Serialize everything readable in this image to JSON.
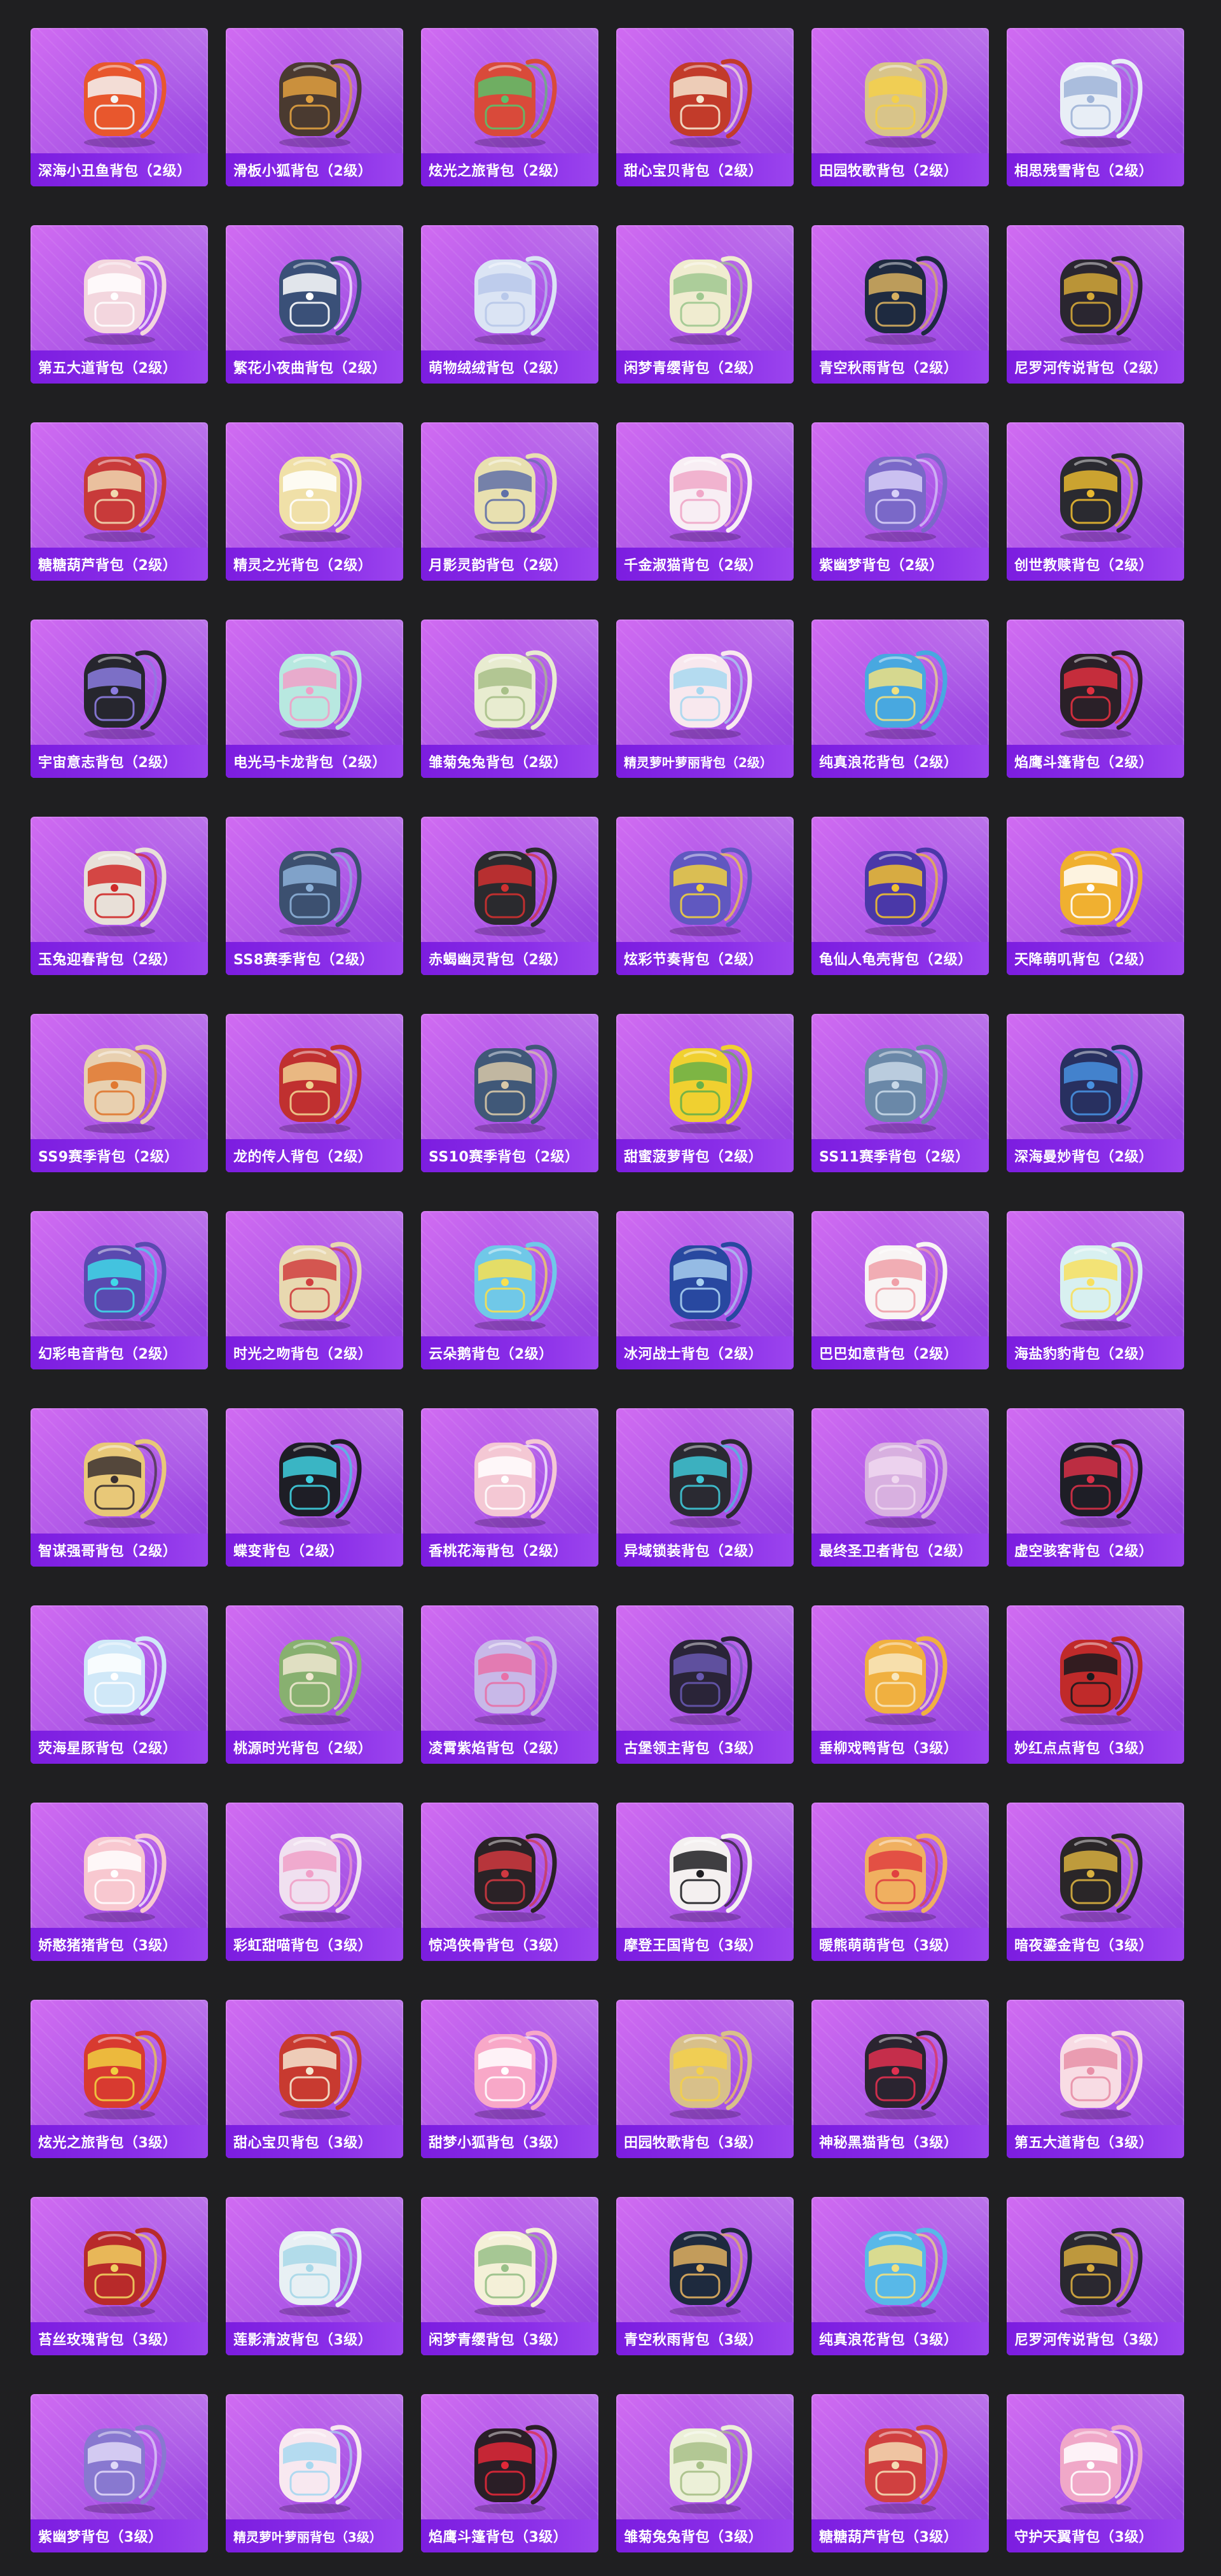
{
  "items": [
    {
      "label": "深海小丑鱼背包（2级）",
      "icon": "clownfish-backpack-icon",
      "color": "#e8572d",
      "accent": "#f4f4f4"
    },
    {
      "label": "滑板小狐背包（2级）",
      "icon": "skate-fox-backpack-icon",
      "color": "#4a3a30",
      "accent": "#e0a040"
    },
    {
      "label": "炫光之旅背包（2级）",
      "icon": "dazzling-trip-backpack-icon",
      "color": "#d94a3a",
      "accent": "#5cc06a"
    },
    {
      "label": "甜心宝贝背包（2级）",
      "icon": "sweetheart-backpack-icon",
      "color": "#c23b2a",
      "accent": "#f5e6d0"
    },
    {
      "label": "田园牧歌背包（2级）",
      "icon": "pastoral-basket-backpack-icon",
      "color": "#d8c48a",
      "accent": "#f4d04a"
    },
    {
      "label": "相思残雪背包（2级）",
      "icon": "snow-lovesick-backpack-icon",
      "color": "#e8eef6",
      "accent": "#9fb4d8"
    },
    {
      "label": "第五大道背包（2级）",
      "icon": "fifth-avenue-backpack-icon",
      "color": "#f3d6de",
      "accent": "#ffffff"
    },
    {
      "label": "繁花小夜曲背包（2级）",
      "icon": "flower-serenade-backpack-icon",
      "color": "#3a5078",
      "accent": "#ffffff"
    },
    {
      "label": "萌物绒绒背包（2级）",
      "icon": "fluffy-plush-backpack-icon",
      "color": "#dbe4f4",
      "accent": "#b8c8ea"
    },
    {
      "label": "闲梦青缨背包（2级）",
      "icon": "dream-tassel-backpack-icon",
      "color": "#f0ecd0",
      "accent": "#a0c890"
    },
    {
      "label": "青空秋雨背包（2级）",
      "icon": "autumn-rain-backpack-icon",
      "color": "#1e2a40",
      "accent": "#d8b060"
    },
    {
      "label": "尼罗河传说背包（2级）",
      "icon": "nile-legend-backpack-icon",
      "color": "#2a2630",
      "accent": "#d4a838"
    },
    {
      "label": "糖糖葫芦背包（2级）",
      "icon": "candied-haw-backpack-icon",
      "color": "#c83a3a",
      "accent": "#f0d8b0"
    },
    {
      "label": "精灵之光背包（2级）",
      "icon": "elf-light-backpack-icon",
      "color": "#f0e0a8",
      "accent": "#ffffff"
    },
    {
      "label": "月影灵韵背包（2级）",
      "icon": "moon-shadow-backpack-icon",
      "color": "#e8e0b0",
      "accent": "#6070a8"
    },
    {
      "label": "千金淑猫背包（2级）",
      "icon": "lady-cat-backpack-icon",
      "color": "#f8eef4",
      "accent": "#f0a8c8"
    },
    {
      "label": "紫幽梦背包（2级）",
      "icon": "purple-dream-backpack-icon",
      "color": "#7a68c8",
      "accent": "#d8d0f8"
    },
    {
      "label": "创世教赎背包（2级）",
      "icon": "genesis-backpack-icon",
      "color": "#2a2a30",
      "accent": "#e8b830"
    },
    {
      "label": "宇宙意志背包（2级）",
      "icon": "cosmic-will-backpack-icon",
      "color": "#26262e",
      "accent": "#8c7ce0"
    },
    {
      "label": "电光马卡龙背包（2级）",
      "icon": "electric-macaron-backpack-icon",
      "color": "#b8e8e0",
      "accent": "#f0a0c8"
    },
    {
      "label": "雏菊兔兔背包（2级）",
      "icon": "daisy-bunny-backpack-icon",
      "color": "#e8ecd0",
      "accent": "#a8c088"
    },
    {
      "label": "精灵萝叶萝丽背包（2级）",
      "icon": "elf-lolita-backpack-icon",
      "color": "#f8e8ee",
      "accent": "#a8d8f0",
      "small": true
    },
    {
      "label": "纯真浪花背包（2级）",
      "icon": "pure-wave-backpack-icon",
      "color": "#48a8e0",
      "accent": "#f0e080"
    },
    {
      "label": "焰鹰斗篷背包（2级）",
      "icon": "flame-hawk-backpack-icon",
      "color": "#2a2028",
      "accent": "#e03040"
    },
    {
      "label": "玉兔迎春背包（2级）",
      "icon": "jade-rabbit-backpack-icon",
      "color": "#e8e0d8",
      "accent": "#d02a2a"
    },
    {
      "label": "SS8赛季背包（2级）",
      "icon": "ss8-season-backpack-icon",
      "color": "#3c5070",
      "accent": "#8cb0d8"
    },
    {
      "label": "赤蝎幽灵背包（2级）",
      "icon": "scorpion-ghost-backpack-icon",
      "color": "#2a2a2e",
      "accent": "#d03030"
    },
    {
      "label": "炫彩节奏背包（2级）",
      "icon": "rhythm-backpack-icon",
      "color": "#6058c0",
      "accent": "#f0d040"
    },
    {
      "label": "龟仙人龟壳背包（2级）",
      "icon": "turtle-shell-backpack-icon",
      "color": "#4a38a8",
      "accent": "#f0c030"
    },
    {
      "label": "天降萌叽背包（2级）",
      "icon": "cute-chick-backpack-icon",
      "color": "#f0b030",
      "accent": "#ffffff"
    },
    {
      "label": "SS9赛季背包（2级）",
      "icon": "ss9-season-backpack-icon",
      "color": "#e8d0b0",
      "accent": "#e07830"
    },
    {
      "label": "龙的传人背包（2级）",
      "icon": "dragon-heir-backpack-icon",
      "color": "#c03030",
      "accent": "#f0d090"
    },
    {
      "label": "SS10赛季背包（2级）",
      "icon": "ss10-season-backpack-icon",
      "color": "#405878",
      "accent": "#d8c8a8"
    },
    {
      "label": "甜蜜菠萝背包（2级）",
      "icon": "pineapple-backpack-icon",
      "color": "#f0d030",
      "accent": "#68b048"
    },
    {
      "label": "SS11赛季背包（2级）",
      "icon": "ss11-season-backpack-icon",
      "color": "#6a88a8",
      "accent": "#c8d8e8"
    },
    {
      "label": "深海曼妙背包（2级）",
      "icon": "deep-sea-grace-backpack-icon",
      "color": "#283060",
      "accent": "#4890e0"
    },
    {
      "label": "幻彩电音背包（2级）",
      "icon": "electro-music-backpack-icon",
      "color": "#5a4ab0",
      "accent": "#40d8e8"
    },
    {
      "label": "时光之吻背包（2级）",
      "icon": "time-kiss-backpack-icon",
      "color": "#e8d8b0",
      "accent": "#d04040"
    },
    {
      "label": "云朵鹅背包（2级）",
      "icon": "cloud-goose-backpack-icon",
      "color": "#70c8e8",
      "accent": "#f8e050"
    },
    {
      "label": "冰河战士背包（2级）",
      "icon": "glacier-warrior-backpack-icon",
      "color": "#2848a0",
      "accent": "#a8d0f0"
    },
    {
      "label": "巴巴如意背包（2级）",
      "icon": "baba-ruyi-backpack-icon",
      "color": "#f8f4f4",
      "accent": "#f0a0a8"
    },
    {
      "label": "海盐豹豹背包（2级）",
      "icon": "sea-salt-seal-backpack-icon",
      "color": "#d8f0f0",
      "accent": "#f8e060"
    },
    {
      "label": "智谋强哥背包（2级）",
      "icon": "wise-brother-backpack-icon",
      "color": "#e8c878",
      "accent": "#3a3030"
    },
    {
      "label": "蝶变背包（2级）",
      "icon": "butterfly-change-backpack-icon",
      "color": "#1e1e26",
      "accent": "#40d0e0"
    },
    {
      "label": "香桃花海背包（2级）",
      "icon": "peach-blossom-backpack-icon",
      "color": "#f4c8d4",
      "accent": "#ffffff"
    },
    {
      "label": "异域锁装背包（2级）",
      "icon": "exotic-lock-backpack-icon",
      "color": "#2a2a32",
      "accent": "#40c8d8"
    },
    {
      "label": "最终圣卫者背包（2级）",
      "icon": "final-guardian-backpack-icon",
      "color": "#d8b0e0",
      "accent": "#f0d8f0"
    },
    {
      "label": "虚空骇客背包（2级）",
      "icon": "void-hacker-backpack-icon",
      "color": "#1e1e26",
      "accent": "#d83048"
    },
    {
      "label": "荧海星豚背包（2级）",
      "icon": "star-dolphin-backpack-icon",
      "color": "#d0e8f8",
      "accent": "#ffffff"
    },
    {
      "label": "桃源时光背包（2级）",
      "icon": "peach-garden-backpack-icon",
      "color": "#88b070",
      "accent": "#f0e8d0"
    },
    {
      "label": "凌霄紫焰背包（2级）",
      "icon": "purple-flame-backpack-icon",
      "color": "#c8b8e8",
      "accent": "#e870a8"
    },
    {
      "label": "古堡领主背包（3级）",
      "icon": "castle-lord-backpack-icon",
      "color": "#2a2438",
      "accent": "#6858b0"
    },
    {
      "label": "垂柳戏鸭背包（3级）",
      "icon": "willow-duck-backpack-icon",
      "color": "#f0b040",
      "accent": "#f8e8c0"
    },
    {
      "label": "妙红点点背包（3级）",
      "icon": "red-dots-backpack-icon",
      "color": "#c02a2a",
      "accent": "#1a1a1e"
    },
    {
      "label": "娇憨猪猪背包（3级）",
      "icon": "cute-piggy-backpack-icon",
      "color": "#f8c8d0",
      "accent": "#ffffff"
    },
    {
      "label": "彩虹甜喵背包（3级）",
      "icon": "rainbow-cat-backpack-icon",
      "color": "#f0e0f0",
      "accent": "#f0a0c8"
    },
    {
      "label": "惊鸿侠骨背包（3级）",
      "icon": "swift-knight-backpack-icon",
      "color": "#2a2226",
      "accent": "#d03840"
    },
    {
      "label": "摩登王国背包（3级）",
      "icon": "modern-kingdom-backpack-icon",
      "color": "#f4f0f0",
      "accent": "#1e1e22"
    },
    {
      "label": "暖熊萌萌背包（3级）",
      "icon": "warm-bear-backpack-icon",
      "color": "#f0b060",
      "accent": "#e04040"
    },
    {
      "label": "暗夜鎏金背包（3级）",
      "icon": "dark-gold-backpack-icon",
      "color": "#2a2628",
      "accent": "#d8b040"
    },
    {
      "label": "炫光之旅背包（3级）",
      "icon": "dazzling-trip-lv3-backpack-icon",
      "color": "#d83a30",
      "accent": "#f0d040"
    },
    {
      "label": "甜心宝贝背包（3级）",
      "icon": "sweetheart-lv3-backpack-icon",
      "color": "#c83a30",
      "accent": "#f5e6d0"
    },
    {
      "label": "甜梦小狐背包（3级）",
      "icon": "sweet-fox-backpack-icon",
      "color": "#f8a8c8",
      "accent": "#ffffff"
    },
    {
      "label": "田园牧歌背包（3级）",
      "icon": "pastoral-lv3-backpack-icon",
      "color": "#d8c08a",
      "accent": "#f4d04a"
    },
    {
      "label": "神秘黑猫背包（3级）",
      "icon": "mystic-cat-backpack-icon",
      "color": "#2a2430",
      "accent": "#e03050"
    },
    {
      "label": "第五大道背包（3级）",
      "icon": "fifth-avenue-lv3-backpack-icon",
      "color": "#f8dce4",
      "accent": "#e890a8"
    },
    {
      "label": "苔丝玫瑰背包（3级）",
      "icon": "tess-rose-backpack-icon",
      "color": "#b82a2a",
      "accent": "#f0d060"
    },
    {
      "label": "莲影清波背包（3级）",
      "icon": "lotus-shadow-backpack-icon",
      "color": "#e8f0f4",
      "accent": "#a8d8e8"
    },
    {
      "label": "闲梦青缨背包（3级）",
      "icon": "dream-tassel-lv3-backpack-icon",
      "color": "#f4f0d8",
      "accent": "#98c088"
    },
    {
      "label": "青空秋雨背包（3级）",
      "icon": "autumn-rain-lv3-backpack-icon",
      "color": "#1e2a3e",
      "accent": "#e0b060"
    },
    {
      "label": "纯真浪花背包（3级）",
      "icon": "pure-wave-lv3-backpack-icon",
      "color": "#58b8e8",
      "accent": "#f0e080"
    },
    {
      "label": "尼罗河传说背包（3级）",
      "icon": "nile-legend-lv3-backpack-icon",
      "color": "#2a2830",
      "accent": "#d8ac40"
    },
    {
      "label": "紫幽梦背包（3级）",
      "icon": "purple-dream-lv3-backpack-icon",
      "color": "#8878d0",
      "accent": "#e0d8f8"
    },
    {
      "label": "精灵萝叶萝丽背包（3级）",
      "icon": "elf-lolita-lv3-backpack-icon",
      "color": "#f8e8f0",
      "accent": "#a8d8f0",
      "small": true
    },
    {
      "label": "焰鹰斗篷背包（3级）",
      "icon": "flame-hawk-lv3-backpack-icon",
      "color": "#2a1e26",
      "accent": "#e02838"
    },
    {
      "label": "雏菊兔兔背包（3级）",
      "icon": "daisy-bunny-lv3-backpack-icon",
      "color": "#ecf0d8",
      "accent": "#a8c088"
    },
    {
      "label": "糖糖葫芦背包（3级）",
      "icon": "candied-haw-lv3-backpack-icon",
      "color": "#d04040",
      "accent": "#f4dcb4"
    },
    {
      "label": "守护天翼背包（3级）",
      "icon": "guardian-wings-backpack-icon",
      "color": "#f0a8c8",
      "accent": "#ffffff"
    }
  ]
}
